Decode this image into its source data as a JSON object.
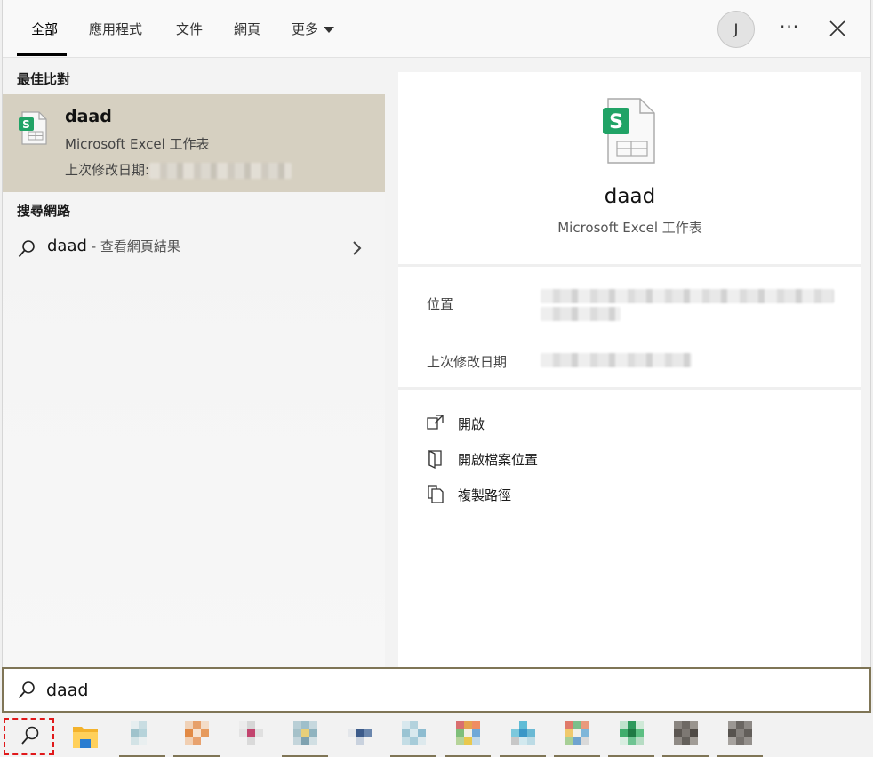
{
  "tabs": [
    {
      "label": "全部",
      "active": true
    },
    {
      "label": "應用程式"
    },
    {
      "label": "文件"
    },
    {
      "label": "網頁"
    },
    {
      "label": "更多"
    }
  ],
  "user": {
    "initial": "J"
  },
  "left": {
    "best_match_title": "最佳比對",
    "best_match": {
      "name": "daad",
      "type": "Microsoft Excel 工作表",
      "modified_label": "上次修改日期:"
    },
    "web_title": "搜尋網路",
    "web_result": {
      "query": "daad",
      "suffix": " - 查看網頁結果"
    }
  },
  "preview": {
    "name": "daad",
    "type": "Microsoft Excel 工作表",
    "location_label": "位置",
    "modified_label": "上次修改日期",
    "actions": [
      {
        "label": "開啟",
        "icon": "open-icon"
      },
      {
        "label": "開啟檔案位置",
        "icon": "folder-location-icon"
      },
      {
        "label": "複製路徑",
        "icon": "copy-path-icon"
      }
    ]
  },
  "searchbox": {
    "value": "daad"
  },
  "colors": {
    "selected_bg": "#d6d0c1",
    "accent_border": "#7f7556",
    "excel_green": "#21a366",
    "highlight_dash": "#e0191b"
  }
}
